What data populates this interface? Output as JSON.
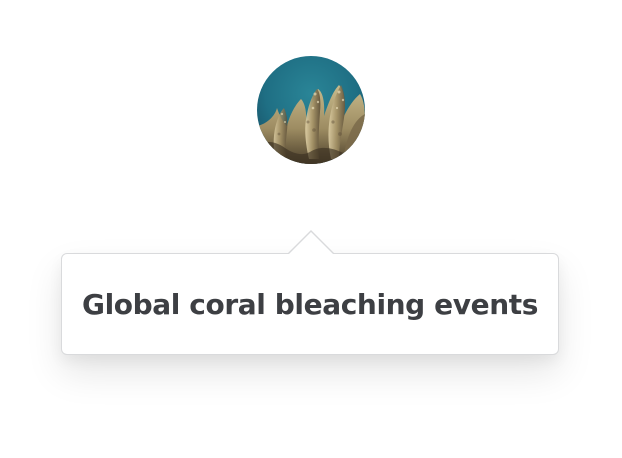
{
  "avatar": {
    "alt": "coral avatar",
    "icon": "coral-photo"
  },
  "tooltip": {
    "text": "Global coral bleaching events"
  },
  "colors": {
    "background": "#ffffff",
    "tooltip_border": "#d9dadc",
    "tooltip_text": "#3d3f43",
    "water": "#1f6f84",
    "coral": "#b7a779"
  }
}
